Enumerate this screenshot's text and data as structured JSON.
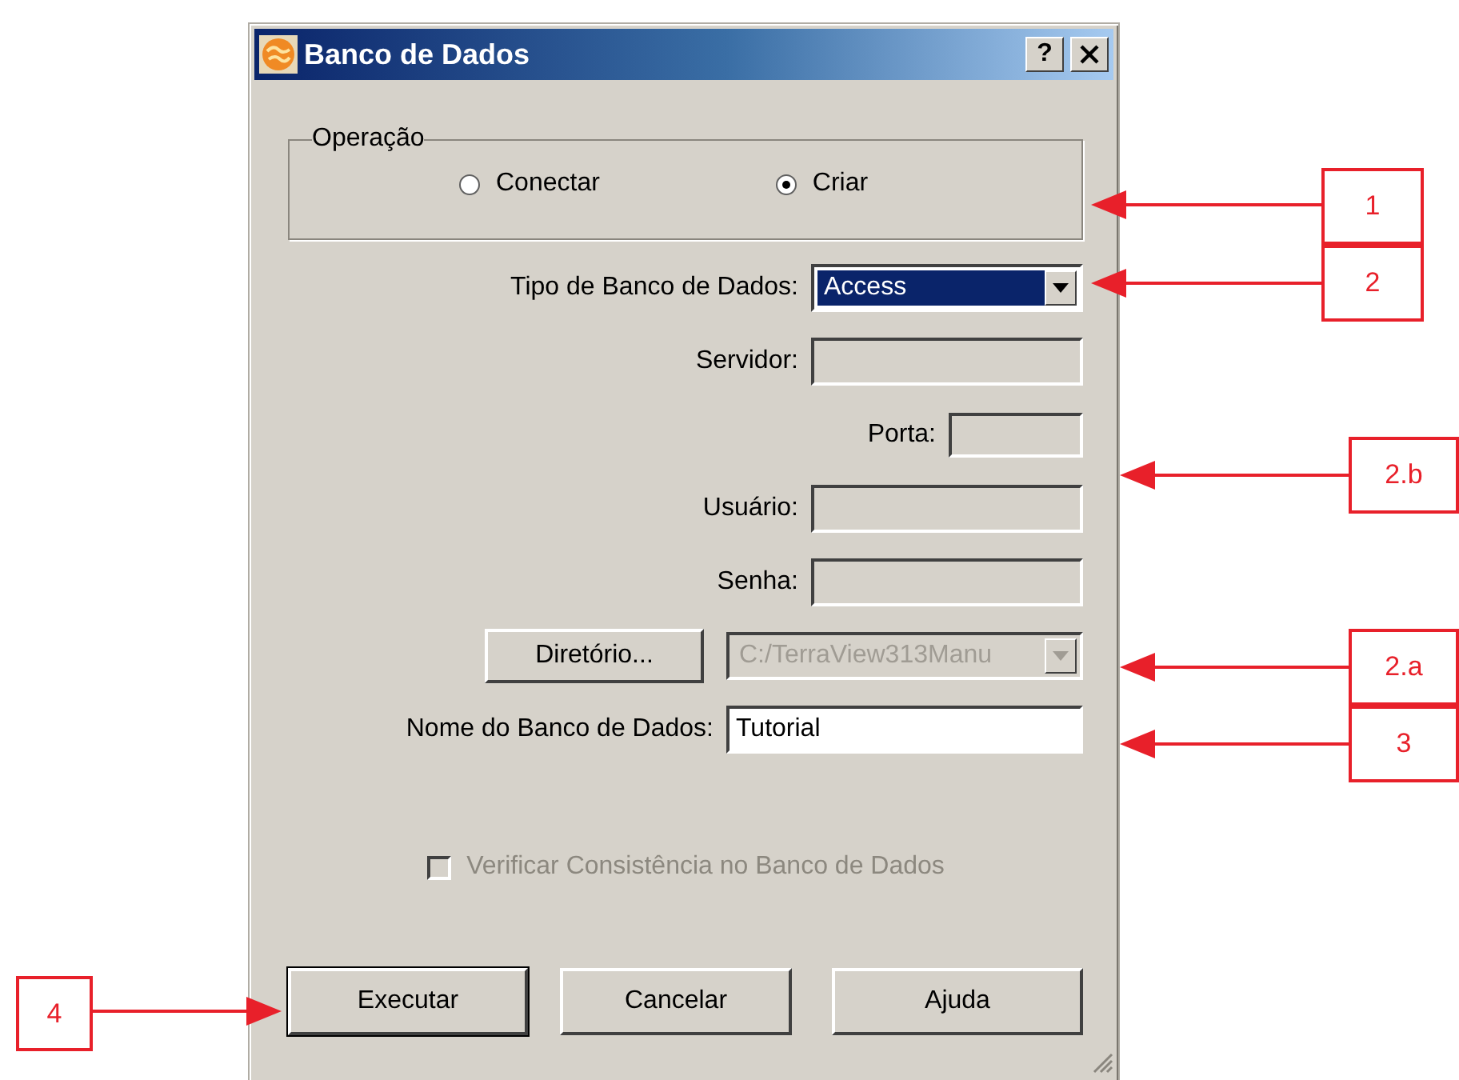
{
  "window": {
    "title": "Banco de Dados",
    "help_button": "?"
  },
  "operation": {
    "label": "Operação",
    "options": [
      {
        "label": "Conectar",
        "selected": false
      },
      {
        "label": "Criar",
        "selected": true
      }
    ]
  },
  "fields": [
    {
      "kind": "select",
      "label": "Tipo de Banco de Dados:",
      "value": "Access",
      "disabled": false
    },
    {
      "kind": "text",
      "label": "Servidor:",
      "disabled": true
    },
    {
      "kind": "short-text",
      "label": "Porta:",
      "disabled": true
    },
    {
      "kind": "text",
      "label": "Usuário:",
      "disabled": true
    },
    {
      "kind": "text",
      "label": "Senha:",
      "disabled": true
    },
    {
      "kind": "directory",
      "button": "Diretório...",
      "value": "C:/TerraView313Manu",
      "disabled": true
    },
    {
      "kind": "wide-text",
      "label": "Nome do Banco de Dados:",
      "value": "Tutorial",
      "disabled": false
    }
  ],
  "checkbox": {
    "label": "Verificar Consistência no Banco de Dados",
    "checked": false,
    "disabled": true
  },
  "buttons": [
    "Executar",
    "Cancelar",
    "Ajuda"
  ],
  "callouts": [
    "1",
    "2",
    "2.b",
    "2.a",
    "3",
    "4"
  ]
}
